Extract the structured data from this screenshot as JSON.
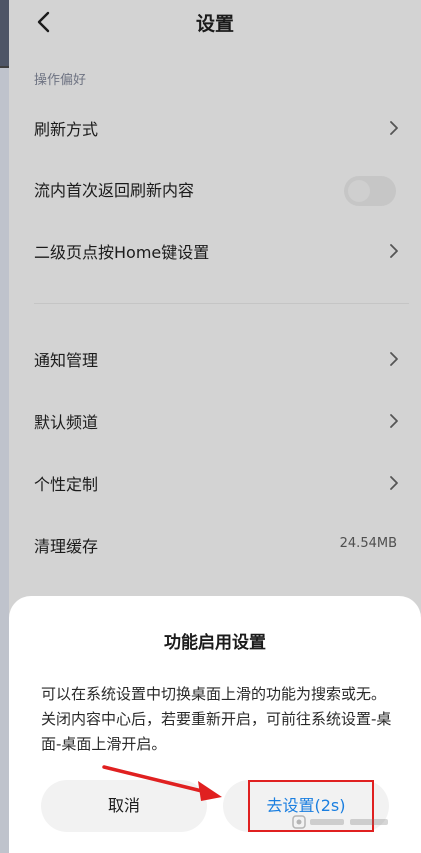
{
  "header": {
    "title": "设置",
    "back_icon": "chevron-left-icon"
  },
  "section_label": "操作偏好",
  "rows": [
    {
      "label": "刷新方式",
      "kind": "link",
      "icon": "chevron-right-icon"
    },
    {
      "label": "流内首次返回刷新内容",
      "kind": "toggle",
      "on": false
    },
    {
      "label": "二级页点按Home键设置",
      "kind": "link",
      "icon": "chevron-right-icon"
    },
    {
      "label": "通知管理",
      "kind": "link",
      "icon": "chevron-right-icon"
    },
    {
      "label": "默认频道",
      "kind": "link",
      "icon": "chevron-right-icon"
    },
    {
      "label": "个性定制",
      "kind": "link",
      "icon": "chevron-right-icon"
    },
    {
      "label": "清理缓存",
      "kind": "value",
      "value": "24.54MB"
    }
  ],
  "dialog": {
    "title": "功能启用设置",
    "message": "可以在系统设置中切换桌面上滑的功能为搜索或无。关闭内容中心后，若要重新开启，可前往系统设置-桌面-桌面上滑开启。",
    "cancel_label": "取消",
    "confirm_label": "去设置(2s)"
  },
  "colors": {
    "accent": "#1b7fe0",
    "annotation": "#e02020",
    "overlay_bg": "#d3d3d3"
  }
}
